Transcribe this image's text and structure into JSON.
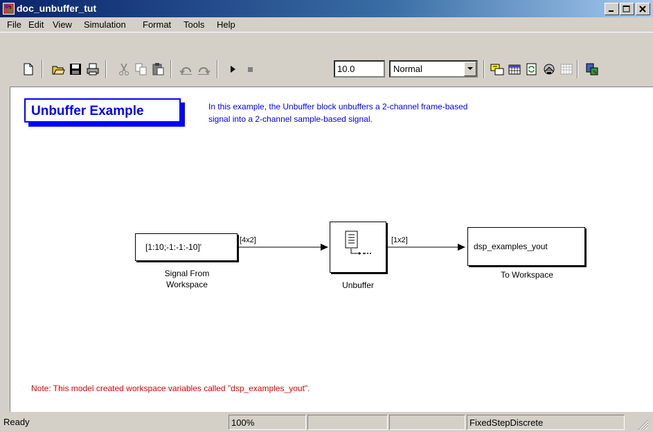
{
  "window": {
    "title": "doc_unbuffer_tut",
    "controls": {
      "minimize": "minimize-icon",
      "maximize": "maximize-icon",
      "close": "close-icon"
    }
  },
  "menu": [
    "File",
    "Edit",
    "View",
    "Simulation",
    "Format",
    "Tools",
    "Help"
  ],
  "toolbar": {
    "stop_time": "10.0",
    "sim_mode": "Normal"
  },
  "canvas": {
    "title": "Unbuffer Example",
    "description_line1": "In this example, the Unbuffer block unbuffers a 2-channel frame-based",
    "description_line2": "signal into a 2-channel sample-based signal.",
    "blocks": {
      "source": {
        "value": "[1:10;-1:-1:-10]'",
        "label_line1": "Signal From",
        "label_line2": "Workspace"
      },
      "unbuffer": {
        "label": "Unbuffer"
      },
      "sink": {
        "value": "dsp_examples_yout",
        "label": "To Workspace"
      }
    },
    "signals": {
      "in": "[4x2]",
      "out": "[1x2]"
    },
    "note": "Note: This model created workspace variables called \"dsp_examples_yout\"."
  },
  "status": {
    "state": "Ready",
    "zoom": "100%",
    "pane3": "",
    "pane4": "",
    "solver": "FixedStepDiscrete"
  },
  "colors": {
    "title_accent": "#0000ff",
    "note": "#e00000",
    "titlebar": "#0a246a"
  }
}
